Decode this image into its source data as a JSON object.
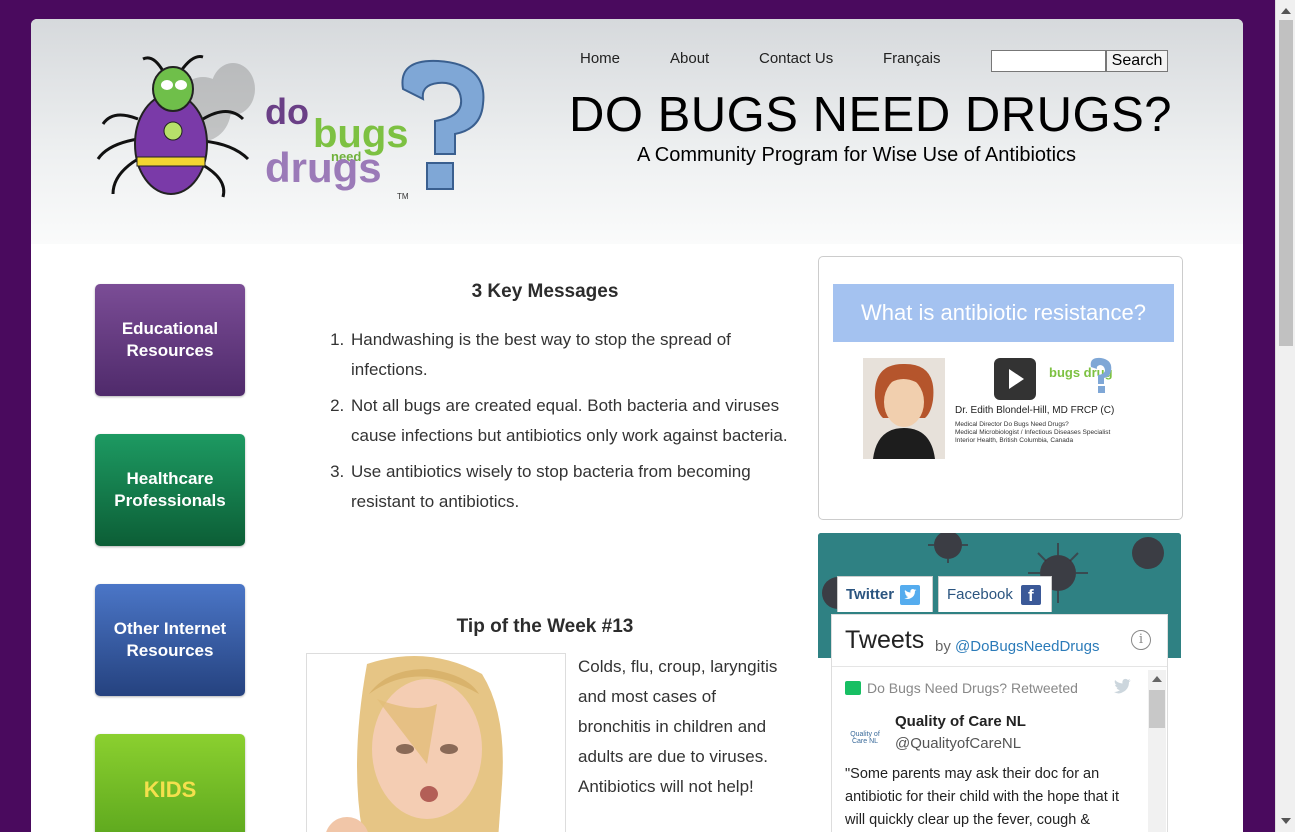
{
  "header": {
    "nav": [
      "Home",
      "About",
      "Contact Us",
      "Français"
    ],
    "search_placeholder": "",
    "search_button": "Search",
    "title": "DO BUGS NEED DRUGS?",
    "subtitle": "A Community Program for Wise Use of Antibiotics",
    "logo_text": {
      "top": "do",
      "middle": "bugs",
      "small": "need",
      "bottom": "drugs",
      "tm": "TM"
    }
  },
  "sidebar": {
    "items": [
      "Educational Resources",
      "Healthcare Professionals",
      "Other Internet Resources",
      "KIDS"
    ]
  },
  "key_messages": {
    "heading": "3 Key Messages",
    "items": [
      "Handwashing is the best way to stop the spread of infections.",
      "Not all bugs are created equal. Both bacteria and viruses cause infections but antibiotics only work against bacteria.",
      "Use antibiotics wisely to stop bacteria from becoming resistant to antibiotics."
    ]
  },
  "tip": {
    "heading": "Tip of the Week #13",
    "text": "Colds, flu, croup, laryngitis and most cases of bronchitis in children and adults are due to viruses. Antibiotics will not help!"
  },
  "video": {
    "banner": "What is antibiotic resistance?",
    "doctor_name": "Dr. Edith Blondel-Hill, MD FRCP (C)",
    "doctor_details": [
      "Medical Director Do Bugs Need Drugs?",
      "Medical Microbiologist / Infectious Diseases Specialist",
      "Interior Health, British Columbia, Canada"
    ],
    "mini_logo": "bugs drugs"
  },
  "social": {
    "tab_twitter": "Twitter",
    "tab_facebook": "Facebook",
    "facebook_glyph": "f",
    "tweets_title": "Tweets",
    "tweets_by": "by",
    "tweets_handle": "@DoBugsNeedDrugs",
    "info_glyph": "i",
    "retweet_label": "Do Bugs Need Drugs? Retweeted",
    "author_avatar": "Quality of Care NL",
    "author_name": "Quality of Care NL",
    "author_handle": "@QualityofCareNL",
    "tweet_text": "\"Some parents may ask their doc for an antibiotic for their child with the hope that it will quickly clear up the fever, cough &"
  },
  "colors": {
    "page_background": "#4a0a5e",
    "edu": "#6a3f86",
    "health": "#177f4d",
    "other": "#3a62ad",
    "kids": "#78c02a",
    "link": "#2b5580"
  }
}
